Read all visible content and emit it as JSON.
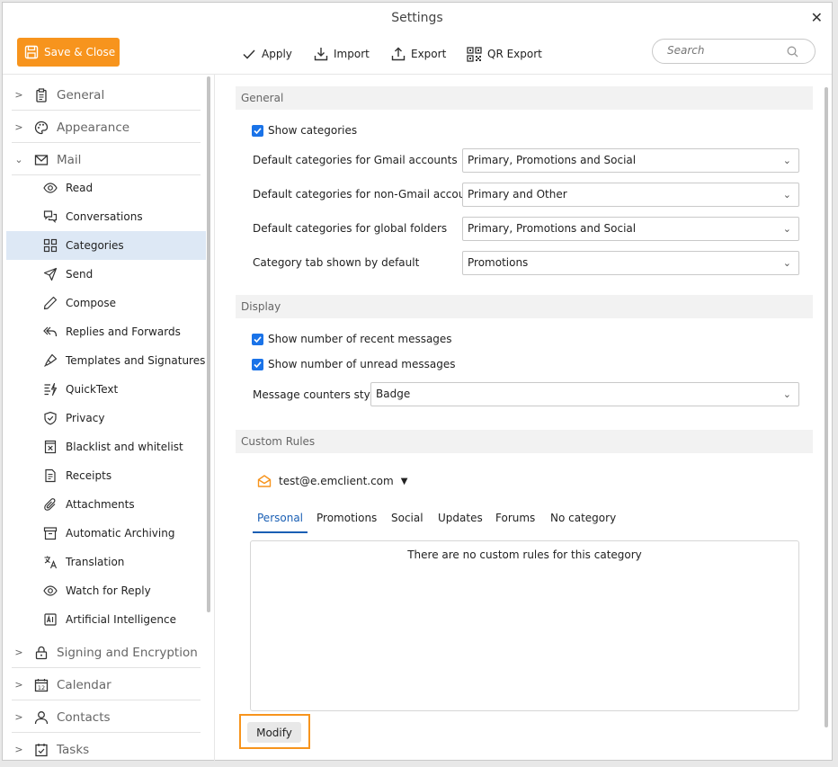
{
  "window": {
    "title": "Settings"
  },
  "toolbar": {
    "save_close": "Save & Close",
    "apply": "Apply",
    "import": "Import",
    "export": "Export",
    "qr_export": "QR Export",
    "search_placeholder": "Search"
  },
  "sidebar": {
    "general": "General",
    "appearance": "Appearance",
    "mail": "Mail",
    "mail_items": [
      "Read",
      "Conversations",
      "Categories",
      "Send",
      "Compose",
      "Replies and Forwards",
      "Templates and Signatures",
      "QuickText",
      "Privacy",
      "Blacklist and whitelist",
      "Receipts",
      "Attachments",
      "Automatic Archiving",
      "Translation",
      "Watch for Reply",
      "Artificial Intelligence"
    ],
    "signing": "Signing and Encryption",
    "calendar": "Calendar",
    "contacts": "Contacts",
    "tasks": "Tasks"
  },
  "general": {
    "header": "General",
    "show_categories": "Show categories",
    "gmail_label": "Default categories for Gmail accounts",
    "gmail_value": "Primary, Promotions and Social",
    "nongmail_label": "Default categories for non-Gmail accounts",
    "nongmail_value": "Primary and Other",
    "global_label": "Default categories for global folders",
    "global_value": "Primary, Promotions and Social",
    "tab_label": "Category tab shown by default",
    "tab_value": "Promotions"
  },
  "display": {
    "header": "Display",
    "recent": "Show number of recent messages",
    "unread": "Show number of unread messages",
    "style_label": "Message counters style",
    "style_value": "Badge"
  },
  "custom_rules": {
    "header": "Custom Rules",
    "account": "test@e.emclient.com",
    "tabs": [
      "Personal",
      "Promotions",
      "Social",
      "Updates",
      "Forums",
      "No category"
    ],
    "empty": "There are no custom rules for this category",
    "modify": "Modify"
  },
  "colors": {
    "accent": "#f7941d",
    "check": "#1a73e8",
    "active_tab": "#1a5fb4",
    "selected_row": "#dde8f5"
  }
}
